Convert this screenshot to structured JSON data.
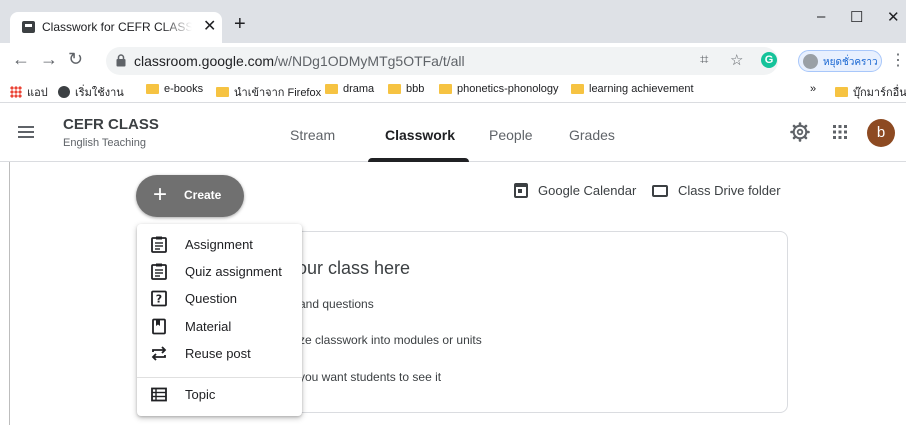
{
  "browser": {
    "tab_title": "Classwork for CEFR CLASS English Teaching",
    "tab_close": "✕",
    "new_tab": "+",
    "window_minimize": "–",
    "window_maximize": "☐",
    "window_close": "✕",
    "url_host": "classroom.google.com",
    "url_path": "/w/NDg1ODMyMTg5OTFa/t/all",
    "profile_label": "หยุดชั่วคราว",
    "extension_letter": "G",
    "bookmarks": {
      "apps": "แอป",
      "getting_started": "เริ่มใช้งาน",
      "items": [
        "e-books",
        "นำเข้าจาก Firefox",
        "drama",
        "bbb",
        "phonetics-phonology",
        "learning achievement"
      ],
      "overflow": "»",
      "other": "บุ๊กมาร์กอื่นๆ"
    }
  },
  "header": {
    "class_name": "CEFR CLASS",
    "class_subtitle": "English Teaching",
    "tabs": [
      {
        "label": "Stream"
      },
      {
        "label": "Classwork"
      },
      {
        "label": "People"
      },
      {
        "label": "Grades"
      }
    ],
    "active_tab": "Classwork",
    "avatar_letter": "b"
  },
  "main": {
    "create_label": "Create",
    "create_plus": "+",
    "google_calendar": "Google Calendar",
    "class_drive_folder": "Class Drive folder",
    "card_title": "our class here",
    "card_lines": [
      "and questions",
      "ze classwork into modules or units",
      "you want students to see it"
    ]
  },
  "create_menu": {
    "items": [
      {
        "label": "Assignment",
        "icon": "assignment-icon"
      },
      {
        "label": "Quiz assignment",
        "icon": "quiz-assignment-icon"
      },
      {
        "label": "Question",
        "icon": "question-icon"
      },
      {
        "label": "Material",
        "icon": "material-icon"
      },
      {
        "label": "Reuse post",
        "icon": "reuse-post-icon"
      },
      {
        "label": "Topic",
        "icon": "topic-icon"
      }
    ]
  },
  "colors": {
    "create_button": "#707070",
    "avatar": "#8d4a22",
    "tabstrip": "#dee1e6"
  }
}
